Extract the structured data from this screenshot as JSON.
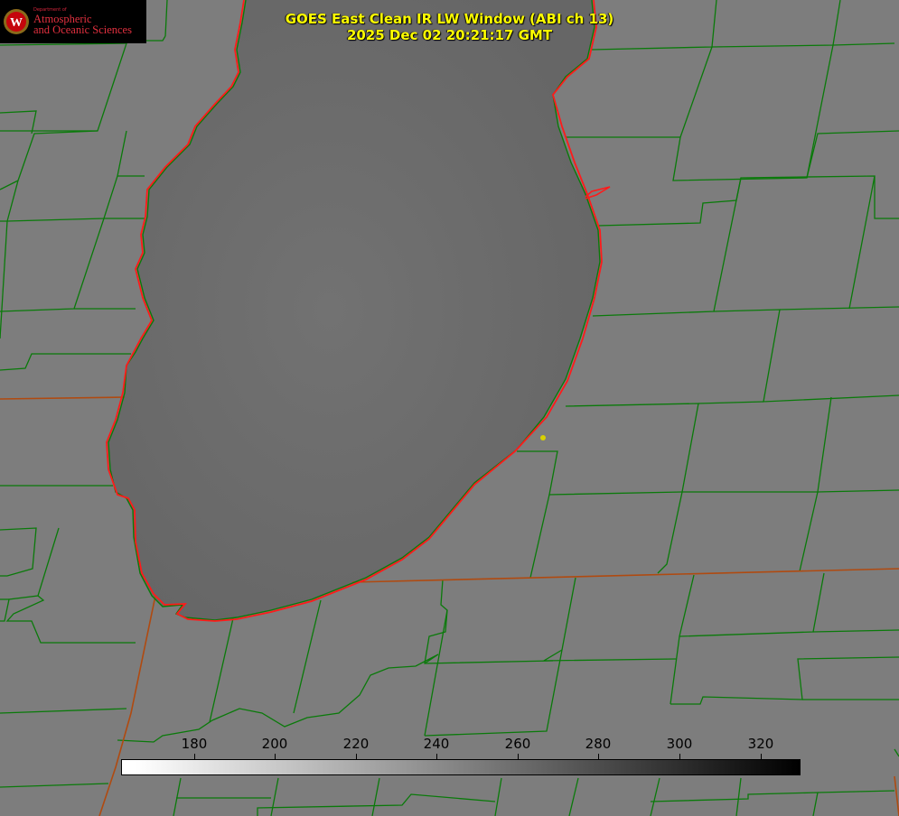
{
  "logo": {
    "department": "Department of",
    "line1": "Atmospheric",
    "line2": "and Oceanic Sciences",
    "seal_letter": "W",
    "icon": "university-seal-icon",
    "colors": {
      "background": "#000000",
      "text": "#e2303f"
    }
  },
  "title": {
    "line1": "GOES East Clean IR LW Window (ABI ch 13)",
    "line2": "2025 Dec 02 20:21:17 GMT",
    "color": "#ffff00"
  },
  "colorbar": {
    "ticks": [
      "180",
      "200",
      "220",
      "240",
      "260",
      "280",
      "300",
      "320"
    ],
    "colors": {
      "low": "#ffffff",
      "high": "#000000"
    }
  },
  "map": {
    "colors": {
      "land": "#7d7d7d",
      "lake": "#6f6f6f",
      "county_lines": "#0a7a0a",
      "coastline": "#ff1a1a",
      "marker": "#d8d000"
    }
  }
}
